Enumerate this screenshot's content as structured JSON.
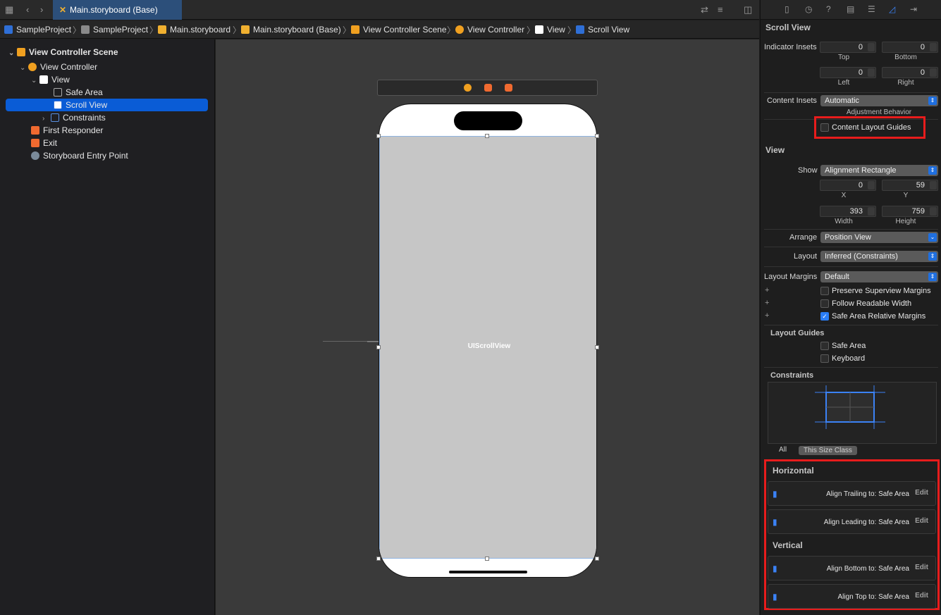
{
  "tab": {
    "title": "Main.storyboard (Base)"
  },
  "breadcrumb": [
    {
      "label": "SampleProject",
      "color": "#2f6fd6"
    },
    {
      "label": "SampleProject",
      "color": "#8a8a8a"
    },
    {
      "label": "Main.storyboard",
      "color": "#f0b030"
    },
    {
      "label": "Main.storyboard (Base)",
      "color": "#f0b030"
    },
    {
      "label": "View Controller Scene",
      "color": "#f0a020"
    },
    {
      "label": "View Controller",
      "color": "#f0a020"
    },
    {
      "label": "View",
      "color": "#ffffff"
    },
    {
      "label": "Scroll View",
      "color": "#2f6fd6"
    }
  ],
  "navigator": {
    "scene": "View Controller Scene",
    "view_controller": "View Controller",
    "view": "View",
    "safe_area": "Safe Area",
    "scroll_view": "Scroll View",
    "constraints": "Constraints",
    "first_responder": "First Responder",
    "exit": "Exit",
    "entry_point": "Storyboard Entry Point"
  },
  "canvas": {
    "scroll_label": "UIScrollView"
  },
  "inspector": {
    "scroll_title": "Scroll View",
    "indicator_insets": "Indicator Insets",
    "top_value": "0",
    "top_label": "Top",
    "bottom_value": "0",
    "bottom_label": "Bottom",
    "left_value": "0",
    "left_label": "Left",
    "right_value": "0",
    "right_label": "Right",
    "content_insets": "Content Insets",
    "content_insets_value": "Automatic",
    "adjustment_behavior": "Adjustment Behavior",
    "content_layout_guides": "Content Layout Guides",
    "view_title": "View",
    "show": "Show",
    "show_value": "Alignment Rectangle",
    "x_value": "0",
    "x_label": "X",
    "y_value": "59",
    "y_label": "Y",
    "width_value": "393",
    "width_label": "Width",
    "height_value": "759",
    "height_label": "Height",
    "arrange": "Arrange",
    "arrange_value": "Position View",
    "layout": "Layout",
    "layout_value": "Inferred (Constraints)",
    "layout_margins": "Layout Margins",
    "layout_margins_value": "Default",
    "preserve_margins": "Preserve Superview Margins",
    "follow_readable": "Follow Readable Width",
    "safe_area_margins": "Safe Area Relative Margins",
    "layout_guides": "Layout Guides",
    "lg_safe_area": "Safe Area",
    "lg_keyboard": "Keyboard",
    "constraints": "Constraints",
    "seg_all": "All",
    "seg_size_class": "This Size Class",
    "horizontal": "Horizontal",
    "vertical": "Vertical",
    "c1": "Align Trailing to:  Safe Area",
    "c2": "Align Leading to:  Safe Area",
    "c3": "Align Bottom to:  Safe Area",
    "c4": "Align Top to:  Safe Area",
    "edit": "Edit"
  }
}
